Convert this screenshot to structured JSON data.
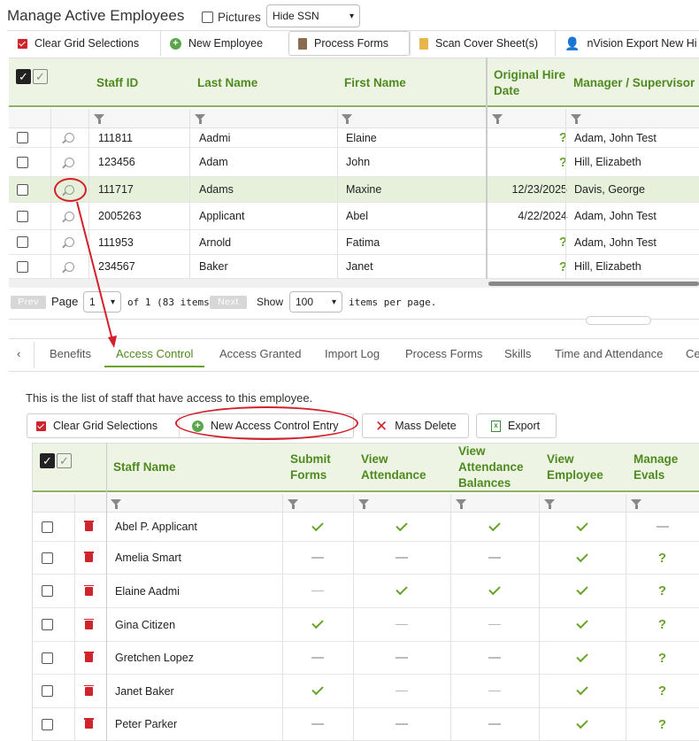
{
  "page": {
    "title": "Manage Active Employees",
    "pictures_label": "Pictures",
    "ssn_select": "Hide SSN"
  },
  "toolbar": {
    "clear": "Clear Grid Selections",
    "new_employee": "New Employee",
    "process_forms": "Process Forms",
    "scan_cover": "Scan Cover Sheet(s)",
    "nvision": "nVision Export New Hi"
  },
  "employees": {
    "columns": {
      "staff_id": "Staff ID",
      "last_name": "Last Name",
      "first_name": "First Name",
      "hire_date_1": "Original Hire",
      "hire_date_2": "Date",
      "manager": "Manager / Supervisor"
    },
    "rows": [
      {
        "id": "111811",
        "last": "Aadmi",
        "first": "Elaine",
        "hire": "?",
        "manager": "Adam, John Test"
      },
      {
        "id": "123456",
        "last": "Adam",
        "first": "John",
        "hire": "?",
        "manager": "Hill, Elizabeth"
      },
      {
        "id": "111717",
        "last": "Adams",
        "first": "Maxine",
        "hire": "12/23/2025",
        "manager": "Davis, George"
      },
      {
        "id": "2005263",
        "last": "Applicant",
        "first": "Abel",
        "hire": "4/22/2024",
        "manager": "Adam, John Test"
      },
      {
        "id": "111953",
        "last": "Arnold",
        "first": "Fatima",
        "hire": "?",
        "manager": "Adam, John Test"
      },
      {
        "id": "234567",
        "last": "Baker",
        "first": "Janet",
        "hire": "?",
        "manager": "Hill, Elizabeth"
      }
    ]
  },
  "pager": {
    "prev": "Prev",
    "page_label": "Page",
    "page_value": "1",
    "of_text": "of 1 (83 items)",
    "next": "Next",
    "show": "Show",
    "per_page_value": "100",
    "per_page_text": "items per page."
  },
  "tabs": [
    "Benefits",
    "Access Control",
    "Access Granted",
    "Import Log",
    "Process Forms",
    "Skills",
    "Time and Attendance",
    "Ce"
  ],
  "tab_prev": "‹",
  "access": {
    "intro": "This is the list of staff that have access to this employee.",
    "clear": "Clear Grid Selections",
    "new_entry": "New Access Control Entry",
    "mass_delete": "Mass Delete",
    "export": "Export",
    "columns": {
      "staff_name": "Staff Name",
      "submit_1": "Submit",
      "submit_2": "Forms",
      "view_att_1": "View",
      "view_att_2": "Attendance",
      "view_bal_1": "View",
      "view_bal_2": "Attendance",
      "view_bal_3": "Balances",
      "view_emp_1": "View",
      "view_emp_2": "Employee",
      "manage_1": "Manage",
      "manage_2": "Evals"
    },
    "rows": [
      {
        "name": "Abel P. Applicant",
        "perms": [
          "check",
          "check",
          "check",
          "check",
          "dash"
        ]
      },
      {
        "name": "Amelia Smart",
        "perms": [
          "dash",
          "dash",
          "dash",
          "check",
          "q"
        ]
      },
      {
        "name": "Elaine Aadmi",
        "perms": [
          "dash",
          "check",
          "check",
          "check",
          "q"
        ]
      },
      {
        "name": "Gina Citizen",
        "perms": [
          "check",
          "dash",
          "dash",
          "check",
          "q"
        ]
      },
      {
        "name": "Gretchen Lopez",
        "perms": [
          "dash",
          "dash",
          "dash",
          "check",
          "q"
        ]
      },
      {
        "name": "Janet Baker",
        "perms": [
          "check",
          "dash",
          "dash",
          "check",
          "q"
        ]
      },
      {
        "name": "Peter Parker",
        "perms": [
          "dash",
          "dash",
          "dash",
          "check",
          "q"
        ]
      }
    ]
  },
  "colors": {
    "accent": "#4e8a1f",
    "highlight": "#d3202a",
    "row_selected": "#e6f0da"
  }
}
